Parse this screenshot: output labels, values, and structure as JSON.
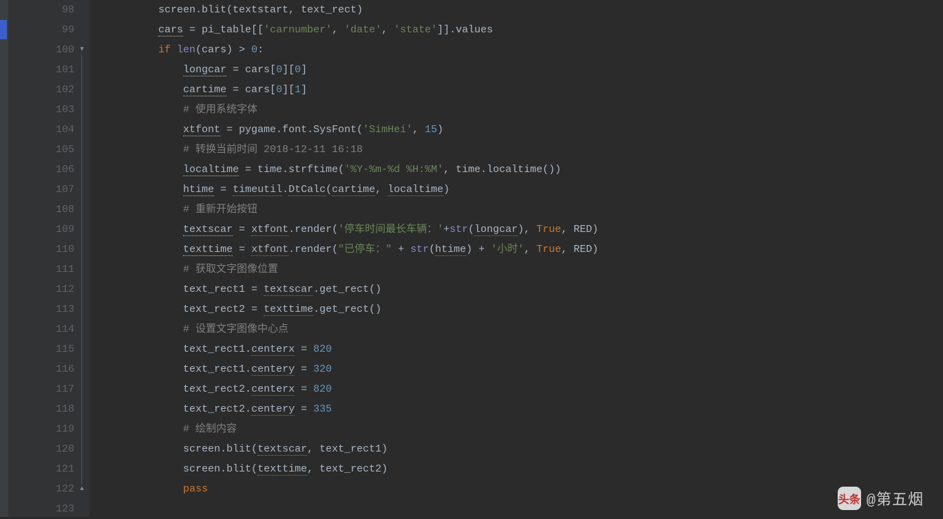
{
  "gutter": {
    "start": 98,
    "end": 123
  },
  "code": {
    "lines": [
      {
        "n": 98,
        "indent": 2,
        "tokens": [
          [
            "fn",
            "screen.blit(textstart"
          ],
          [
            "op",
            ", "
          ],
          [
            "fn",
            "text_rect)"
          ]
        ]
      },
      {
        "n": 99,
        "indent": 2,
        "tokens": [
          [
            "warn",
            "cars"
          ],
          [
            "op",
            " = pi_table[["
          ],
          [
            "str",
            "'carnumber'"
          ],
          [
            "op",
            ", "
          ],
          [
            "str",
            "'date'"
          ],
          [
            "op",
            ", "
          ],
          [
            "str",
            "'state'"
          ],
          [
            "op",
            "]].values"
          ]
        ]
      },
      {
        "n": 100,
        "indent": 2,
        "tokens": [
          [
            "kw",
            "if "
          ],
          [
            "builtin",
            "len"
          ],
          [
            "op",
            "(cars) > "
          ],
          [
            "num",
            "0"
          ],
          [
            "op",
            ":"
          ]
        ]
      },
      {
        "n": 101,
        "indent": 3,
        "tokens": [
          [
            "warn",
            "longcar"
          ],
          [
            "op",
            " = cars["
          ],
          [
            "num",
            "0"
          ],
          [
            "op",
            "]["
          ],
          [
            "num",
            "0"
          ],
          [
            "op",
            "]"
          ]
        ]
      },
      {
        "n": 102,
        "indent": 3,
        "tokens": [
          [
            "warn",
            "cartime"
          ],
          [
            "op",
            " = cars["
          ],
          [
            "num",
            "0"
          ],
          [
            "op",
            "]["
          ],
          [
            "num",
            "1"
          ],
          [
            "op",
            "]"
          ]
        ]
      },
      {
        "n": 103,
        "indent": 3,
        "tokens": [
          [
            "cmt",
            "# 使用系统字体"
          ]
        ]
      },
      {
        "n": 104,
        "indent": 3,
        "tokens": [
          [
            "warn",
            "xtfont"
          ],
          [
            "op",
            " = pygame.font.SysFont("
          ],
          [
            "str",
            "'SimHei'"
          ],
          [
            "op",
            ", "
          ],
          [
            "num",
            "15"
          ],
          [
            "op",
            ")"
          ]
        ]
      },
      {
        "n": 105,
        "indent": 3,
        "tokens": [
          [
            "cmt",
            "# 转换当前时间 2018-12-11 16:18"
          ]
        ]
      },
      {
        "n": 106,
        "indent": 3,
        "tokens": [
          [
            "warn",
            "localtime"
          ],
          [
            "op",
            " = time.strftime("
          ],
          [
            "str",
            "'%Y-%m-%d %H:%M'"
          ],
          [
            "op",
            ", time.localtime())"
          ]
        ]
      },
      {
        "n": 107,
        "indent": 3,
        "tokens": [
          [
            "warn",
            "htime"
          ],
          [
            "op",
            " = "
          ],
          [
            "typo",
            "timeutil"
          ],
          [
            "op",
            "."
          ],
          [
            "typo",
            "DtCalc"
          ],
          [
            "op",
            "("
          ],
          [
            "typo",
            "cartime"
          ],
          [
            "op",
            ", "
          ],
          [
            "typo",
            "localtime"
          ],
          [
            "op",
            ")"
          ]
        ]
      },
      {
        "n": 108,
        "indent": 3,
        "tokens": [
          [
            "cmt",
            "# 重新开始按钮"
          ]
        ]
      },
      {
        "n": 109,
        "indent": 3,
        "tokens": [
          [
            "warn",
            "textscar"
          ],
          [
            "op",
            " = "
          ],
          [
            "typo",
            "xtfont"
          ],
          [
            "op",
            ".render("
          ],
          [
            "str",
            "'停车时间最长车辆：'"
          ],
          [
            "op",
            "+"
          ],
          [
            "builtin",
            "str"
          ],
          [
            "op",
            "("
          ],
          [
            "typo",
            "longcar"
          ],
          [
            "op",
            "), "
          ],
          [
            "kw",
            "True"
          ],
          [
            "op",
            ", RED)"
          ]
        ]
      },
      {
        "n": 110,
        "indent": 3,
        "tokens": [
          [
            "warn",
            "texttime"
          ],
          [
            "op",
            " = "
          ],
          [
            "typo",
            "xtfont"
          ],
          [
            "op",
            ".render("
          ],
          [
            "str",
            "\"已停车：\""
          ],
          [
            "op",
            " + "
          ],
          [
            "builtin",
            "str"
          ],
          [
            "op",
            "("
          ],
          [
            "typo",
            "htime"
          ],
          [
            "op",
            ") + "
          ],
          [
            "str",
            "'小时'"
          ],
          [
            "op",
            ", "
          ],
          [
            "kw",
            "True"
          ],
          [
            "op",
            ", RED)"
          ]
        ]
      },
      {
        "n": 111,
        "indent": 3,
        "tokens": [
          [
            "cmt",
            "# 获取文字图像位置"
          ]
        ]
      },
      {
        "n": 112,
        "indent": 3,
        "tokens": [
          [
            "op",
            "text_rect1 = "
          ],
          [
            "typo",
            "textscar"
          ],
          [
            "op",
            ".get_rect()"
          ]
        ]
      },
      {
        "n": 113,
        "indent": 3,
        "tokens": [
          [
            "op",
            "text_rect2 = "
          ],
          [
            "typo",
            "texttime"
          ],
          [
            "op",
            ".get_rect()"
          ]
        ]
      },
      {
        "n": 114,
        "indent": 3,
        "tokens": [
          [
            "cmt",
            "# 设置文字图像中心点"
          ]
        ]
      },
      {
        "n": 115,
        "indent": 3,
        "tokens": [
          [
            "op",
            "text_rect1."
          ],
          [
            "typo",
            "centerx"
          ],
          [
            "op",
            " = "
          ],
          [
            "num",
            "820"
          ]
        ]
      },
      {
        "n": 116,
        "indent": 3,
        "tokens": [
          [
            "op",
            "text_rect1."
          ],
          [
            "typo",
            "centery"
          ],
          [
            "op",
            " = "
          ],
          [
            "num",
            "320"
          ]
        ]
      },
      {
        "n": 117,
        "indent": 3,
        "tokens": [
          [
            "op",
            "text_rect2."
          ],
          [
            "typo",
            "centerx"
          ],
          [
            "op",
            " = "
          ],
          [
            "num",
            "820"
          ]
        ]
      },
      {
        "n": 118,
        "indent": 3,
        "tokens": [
          [
            "op",
            "text_rect2."
          ],
          [
            "typo",
            "centery"
          ],
          [
            "op",
            " = "
          ],
          [
            "num",
            "335"
          ]
        ]
      },
      {
        "n": 119,
        "indent": 3,
        "tokens": [
          [
            "cmt",
            "# 绘制内容"
          ]
        ]
      },
      {
        "n": 120,
        "indent": 3,
        "tokens": [
          [
            "op",
            "screen.blit("
          ],
          [
            "typo",
            "textscar"
          ],
          [
            "op",
            ", text_rect1)"
          ]
        ]
      },
      {
        "n": 121,
        "indent": 3,
        "tokens": [
          [
            "op",
            "screen.blit("
          ],
          [
            "typo",
            "texttime"
          ],
          [
            "op",
            ", text_rect2)"
          ]
        ]
      },
      {
        "n": 122,
        "indent": 3,
        "tokens": [
          [
            "kw",
            "pass"
          ]
        ]
      },
      {
        "n": 123,
        "indent": 0,
        "tokens": []
      }
    ]
  },
  "watermark": {
    "badge": "头条",
    "text": "@第五烟"
  },
  "fold": {
    "open_at_row_index": 2,
    "close_at_row_index": 24
  }
}
